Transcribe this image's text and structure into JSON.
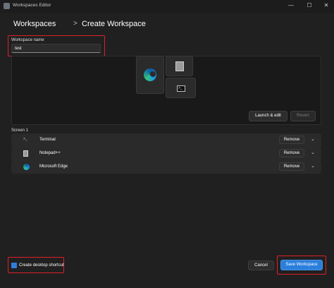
{
  "window": {
    "title": "Workspaces Editor",
    "minimize_glyph": "—",
    "maximize_glyph": "☐",
    "close_glyph": "✕"
  },
  "breadcrumb": {
    "parent": "Workspaces",
    "separator": ">",
    "current": "Create Workspace"
  },
  "workspace_name": {
    "label": "Workspace name",
    "value": "test"
  },
  "preview": {
    "terminal_glyph": ">_",
    "launch_edit_label": "Launch & edit",
    "revert_label": "Revert"
  },
  "screen": {
    "label": "Screen 1",
    "apps": [
      {
        "name": "Terminal",
        "icon": "terminal-icon",
        "glyph": ">_",
        "remove_label": "Remove"
      },
      {
        "name": "Notepad++",
        "icon": "notepad-icon",
        "glyph": "",
        "remove_label": "Remove"
      },
      {
        "name": "Microsoft Edge",
        "icon": "edge-icon",
        "glyph": "",
        "remove_label": "Remove"
      }
    ],
    "chevron_glyph": "⌄"
  },
  "footer": {
    "shortcut_label": "Create desktop shortcut",
    "shortcut_checked": true,
    "cancel_label": "Cancel",
    "save_label": "Save Workspace"
  },
  "colors": {
    "accent": "#2b7fdc",
    "highlight": "#e0202a",
    "background": "#202020"
  }
}
